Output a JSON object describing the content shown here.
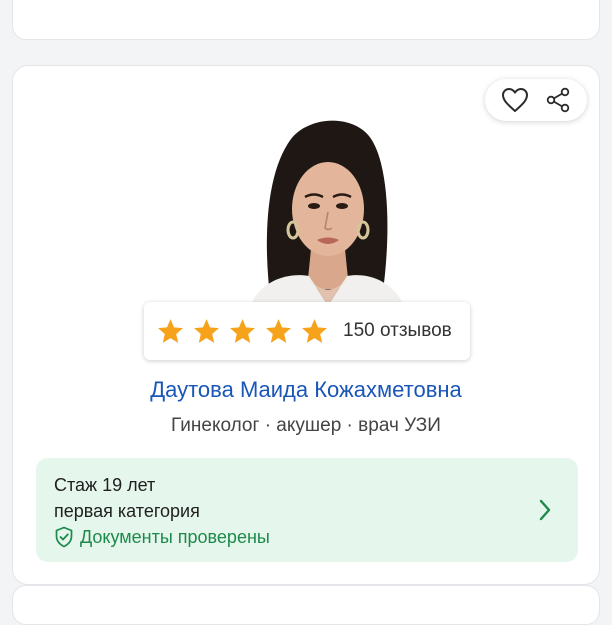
{
  "doctor": {
    "name": "Даутова Маида Кожахметовна",
    "specialties": "Гинеколог · акушер · врач УЗИ",
    "rating": {
      "stars": 5,
      "max_stars": 5,
      "reviews_label": "150 отзывов"
    },
    "info": {
      "experience": "Стаж 19 лет",
      "category": "первая категория",
      "verified": "Документы проверены"
    }
  },
  "icons": {
    "favorite": "heart-icon",
    "share": "share-icon",
    "verified": "shield-check-icon",
    "open": "chevron-right-icon",
    "star": "star-icon"
  },
  "colors": {
    "name_link": "#1a56b8",
    "star": "#f7a21b",
    "info_bg": "#e5f6ec",
    "verified_text": "#1c8a4a"
  }
}
